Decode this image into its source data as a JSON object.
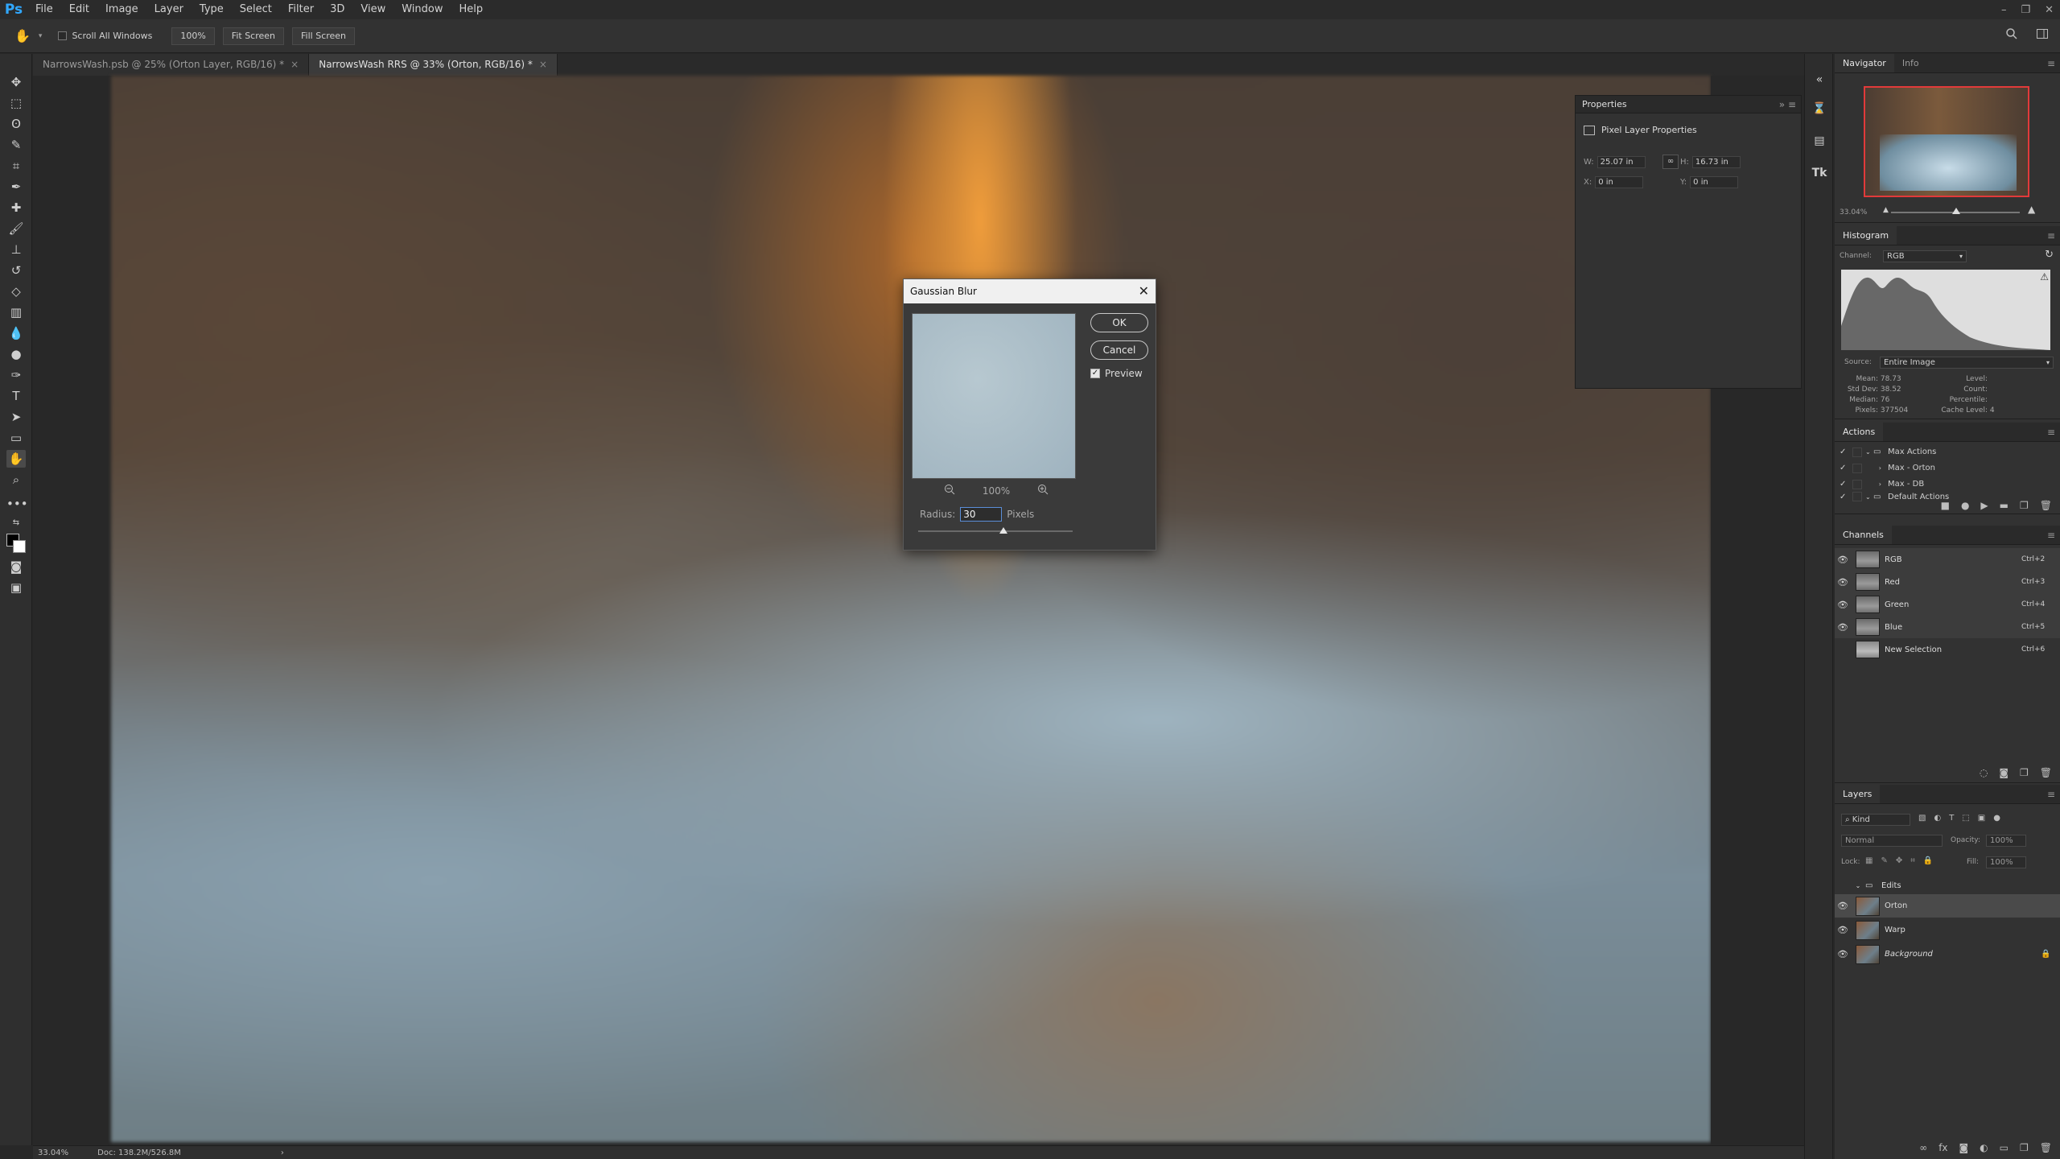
{
  "menubar": {
    "logo": "Ps",
    "items": [
      "File",
      "Edit",
      "Image",
      "Layer",
      "Type",
      "Select",
      "Filter",
      "3D",
      "View",
      "Window",
      "Help"
    ],
    "window_controls": [
      "–",
      "❐",
      "✕"
    ]
  },
  "options": {
    "scroll_all_windows": "Scroll All Windows",
    "zoom_value": "100%",
    "fit_screen": "Fit Screen",
    "fill_screen": "Fill Screen"
  },
  "tabs": [
    {
      "label": "NarrowsWash.psb @ 25% (Orton Layer, RGB/16) *",
      "active": false
    },
    {
      "label": "NarrowsWash RRS @ 33% (Orton, RGB/16) *",
      "active": true
    }
  ],
  "status": {
    "zoom": "33.04%",
    "doc": "Doc: 138.2M/526.8M",
    "arrow": "›"
  },
  "properties": {
    "title": "Properties",
    "subtitle": "Pixel Layer Properties",
    "w_label": "W:",
    "w_value": "25.07 in",
    "h_label": "H:",
    "h_value": "16.73 in",
    "x_label": "X:",
    "x_value": "0 in",
    "y_label": "Y:",
    "y_value": "0 in"
  },
  "navigator": {
    "tab_navigator": "Navigator",
    "tab_info": "Info",
    "zoom": "33.04%"
  },
  "histogram": {
    "title": "Histogram",
    "channel_label": "Channel:",
    "channel_value": "RGB",
    "source_label": "Source:",
    "source_value": "Entire Image",
    "stats_left": [
      {
        "label": "Mean:",
        "value": "78.73"
      },
      {
        "label": "Std Dev:",
        "value": "38.52"
      },
      {
        "label": "Median:",
        "value": "76"
      },
      {
        "label": "Pixels:",
        "value": "377504"
      }
    ],
    "stats_right": [
      {
        "label": "Level:",
        "value": ""
      },
      {
        "label": "Count:",
        "value": ""
      },
      {
        "label": "Percentile:",
        "value": ""
      },
      {
        "label": "Cache Level:",
        "value": "4"
      }
    ]
  },
  "actions": {
    "title": "Actions",
    "items": [
      {
        "label": "Max Actions",
        "indent": 0,
        "type": "folder"
      },
      {
        "label": "Max - Orton",
        "indent": 1,
        "type": "action"
      },
      {
        "label": "Max - DB",
        "indent": 1,
        "type": "action"
      },
      {
        "label": "Default Actions",
        "indent": 0,
        "type": "folder"
      }
    ]
  },
  "channels": {
    "title": "Channels",
    "items": [
      {
        "name": "RGB",
        "shortcut": "Ctrl+2"
      },
      {
        "name": "Red",
        "shortcut": "Ctrl+3"
      },
      {
        "name": "Green",
        "shortcut": "Ctrl+4"
      },
      {
        "name": "Blue",
        "shortcut": "Ctrl+5"
      },
      {
        "name": "New Selection",
        "shortcut": "Ctrl+6"
      }
    ]
  },
  "layers": {
    "title": "Layers",
    "kind": "Kind",
    "blend_mode": "Normal",
    "opacity_label": "Opacity:",
    "opacity_value": "100%",
    "lock_label": "Lock:",
    "fill_label": "Fill:",
    "fill_value": "100%",
    "items": [
      {
        "name": "Edits",
        "type": "group"
      },
      {
        "name": "Orton",
        "type": "pixel"
      },
      {
        "name": "Warp",
        "type": "pixel"
      },
      {
        "name": "Background",
        "type": "background"
      }
    ]
  },
  "gaussian_blur": {
    "title": "Gaussian Blur",
    "ok": "OK",
    "cancel": "Cancel",
    "preview_label": "Preview",
    "preview_checked": true,
    "zoom_percent": "100%",
    "radius_label": "Radius:",
    "radius_value": "30",
    "radius_unit": "Pixels",
    "radius_slider_fraction": 0.55
  },
  "colors": {
    "accent": "#31a8ff",
    "foreground_color": "#000000",
    "background_color": "#ffffff"
  }
}
